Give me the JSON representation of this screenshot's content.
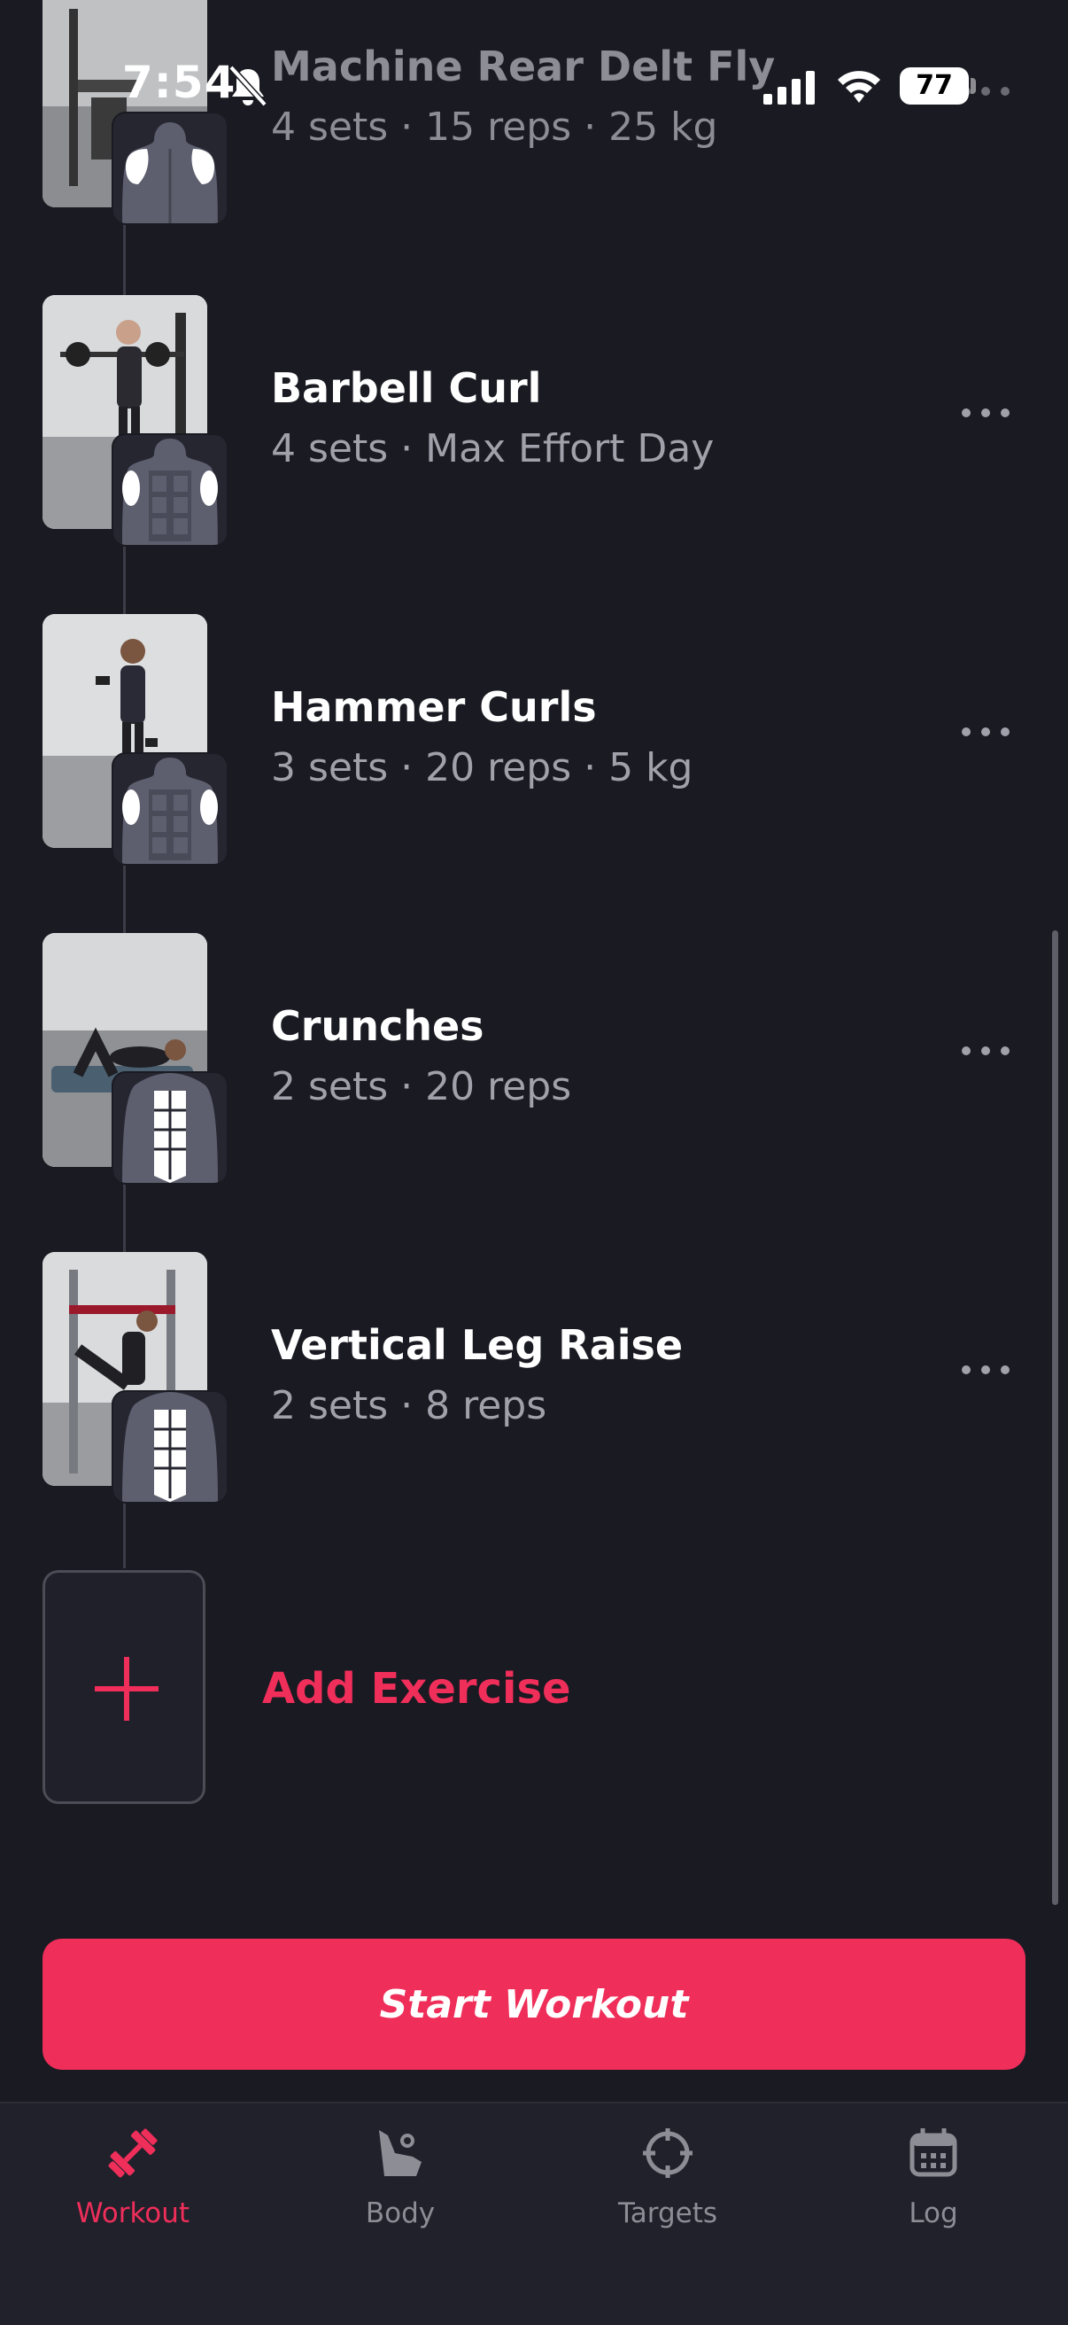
{
  "status_bar": {
    "time": "7:54",
    "battery": "77"
  },
  "exercises": [
    {
      "name": "Machine Rear Delt Fly",
      "detail": "4 sets · 15 reps · 25 kg",
      "target": "rear-delts"
    },
    {
      "name": "Barbell Curl",
      "detail": "4 sets · Max Effort Day",
      "target": "biceps"
    },
    {
      "name": "Hammer Curls",
      "detail": "3 sets · 20 reps · 5 kg",
      "target": "biceps"
    },
    {
      "name": "Crunches",
      "detail": "2 sets · 20 reps",
      "target": "abs"
    },
    {
      "name": "Vertical Leg Raise",
      "detail": "2 sets · 8 reps",
      "target": "abs"
    }
  ],
  "add_exercise": {
    "label": "Add Exercise"
  },
  "start_button": {
    "label": "Start Workout"
  },
  "tabs": [
    {
      "label": "Workout",
      "icon": "dumbbell-icon",
      "active": true
    },
    {
      "label": "Body",
      "icon": "body-icon",
      "active": false
    },
    {
      "label": "Targets",
      "icon": "crosshair-icon",
      "active": false
    },
    {
      "label": "Log",
      "icon": "calendar-icon",
      "active": false
    }
  ],
  "colors": {
    "background": "#1a1a22",
    "accent": "#ef2e5a",
    "secondary_text": "#a1a1ab",
    "tab_bar": "#21212b"
  }
}
